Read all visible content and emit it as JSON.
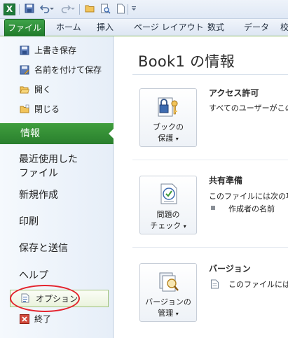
{
  "qat": {
    "app_logo": "X",
    "icons": [
      "excel-logo-icon",
      "save-icon",
      "undo-icon",
      "dropdown-arrow-icon",
      "redo-icon",
      "dropdown-arrow-icon",
      "open-folder-icon",
      "print-preview-icon",
      "new-document-icon",
      "customize-toolbar-icon"
    ]
  },
  "ribbon": {
    "file_tab": "ファイル",
    "tabs": [
      "ホーム",
      "挿入",
      "ページ レイアウト",
      "数式",
      "データ",
      "校"
    ]
  },
  "backstage": {
    "commands_top": [
      {
        "label": "上書き保存",
        "icon": "save-icon"
      },
      {
        "label": "名前を付けて保存",
        "icon": "save-as-icon"
      },
      {
        "label": "開く",
        "icon": "open-folder-icon"
      },
      {
        "label": "閉じる",
        "icon": "close-folder-icon"
      }
    ],
    "active": "情報",
    "nav": [
      "最近使用した",
      "ファイル",
      "新規作成",
      "印刷",
      "保存と送信",
      "ヘルプ"
    ],
    "options": {
      "label": "オプション",
      "icon": "options-icon"
    },
    "exit": {
      "label": "終了",
      "icon": "exit-icon"
    }
  },
  "info": {
    "title": "Book1 の情報",
    "sections": [
      {
        "button_line1": "ブックの",
        "button_line2": "保護",
        "icon": "lock-key-icon",
        "heading": "アクセス許可",
        "desc": "すべてのユーザーがこの"
      },
      {
        "button_line1": "問題の",
        "button_line2": "チェック",
        "icon": "checklist-icon",
        "heading": "共有準備",
        "desc": "このファイルには次の項",
        "bullet": "作成者の名前"
      },
      {
        "button_line1": "バージョンの",
        "button_line2": "管理",
        "icon": "versions-icon",
        "heading": "バージョン",
        "desc": "このファイルには、"
      }
    ]
  },
  "colors": {
    "accent_green": "#2a7f2e",
    "options_highlight_ring": "#e4232d"
  }
}
